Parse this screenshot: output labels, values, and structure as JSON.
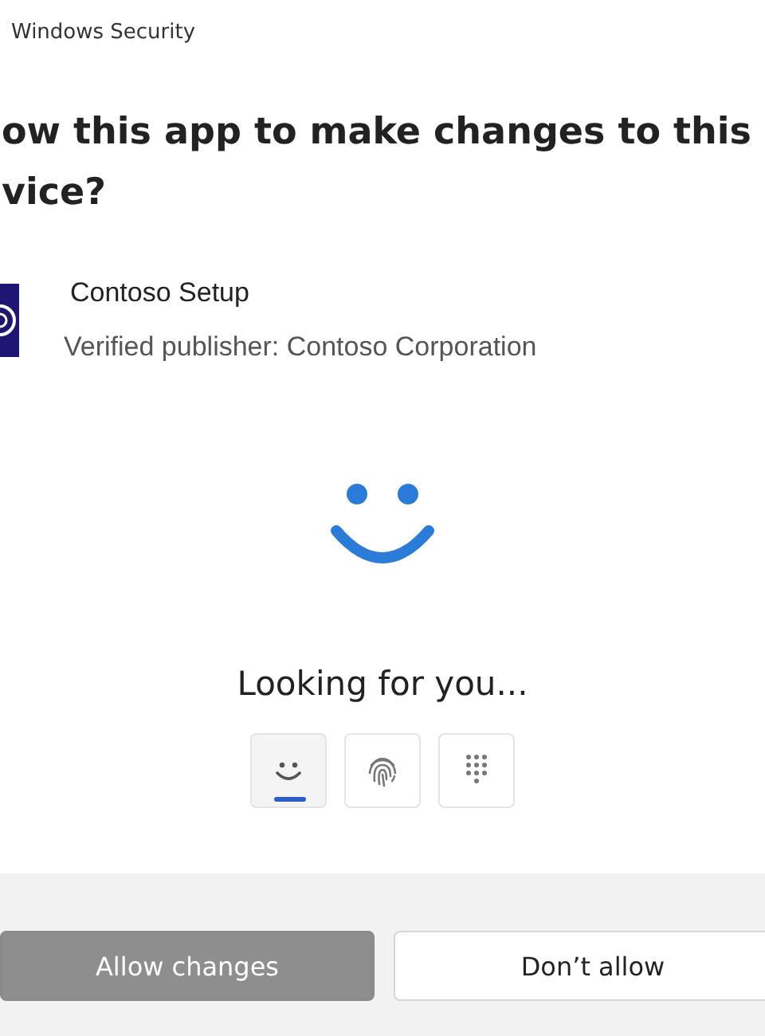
{
  "window": {
    "title": "Windows Security"
  },
  "heading_lines": [
    "ow this app to make changes to this",
    "vice?"
  ],
  "app": {
    "name": "Contoso Setup",
    "publisher": "Verified publisher: Contoso Corporation"
  },
  "status": "Looking for you...",
  "sign_in_options": [
    {
      "kind": "face",
      "selected": true
    },
    {
      "kind": "fingerprint",
      "selected": false
    },
    {
      "kind": "pin",
      "selected": false
    }
  ],
  "buttons": [
    {
      "label": "Allow changes",
      "disabled": true
    },
    {
      "label": "Don’t allow",
      "disabled": false
    }
  ]
}
